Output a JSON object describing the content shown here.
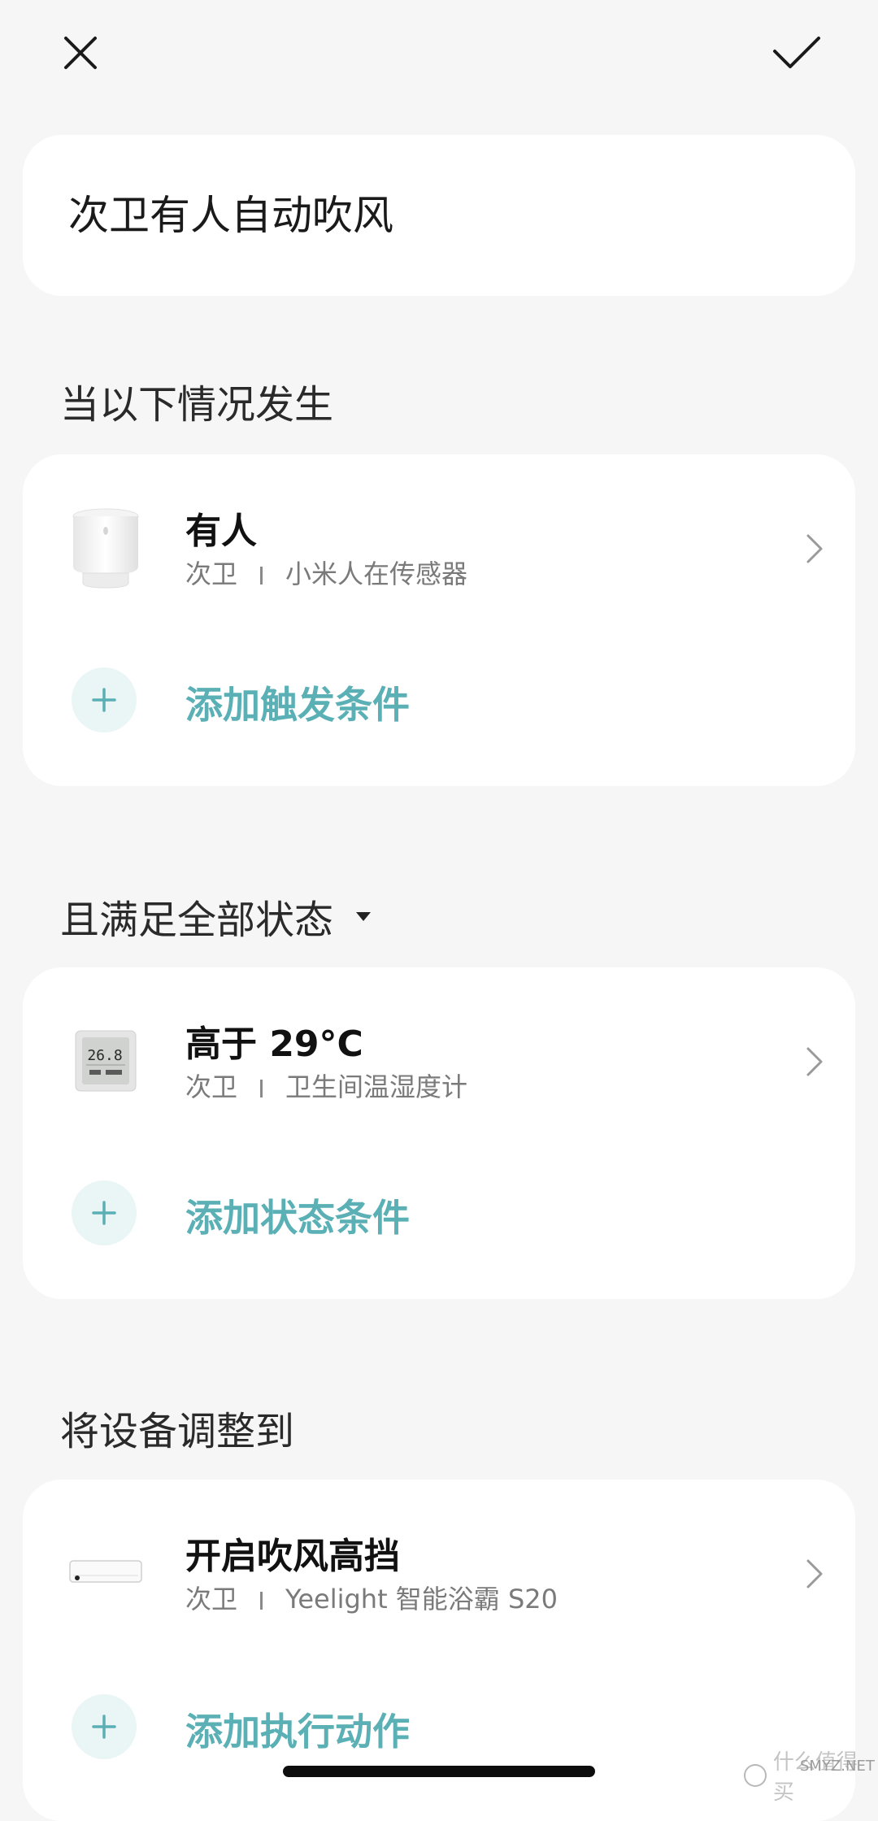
{
  "top_bar": {
    "close_icon": "close-icon",
    "confirm_icon": "check-icon"
  },
  "scene_name": "次卫有人自动吹风",
  "trigger_section": {
    "title": "当以下情况发生",
    "item": {
      "title": "有人",
      "room": "次卫",
      "device": "小米人在传感器",
      "icon": "motion-sensor-icon"
    },
    "add_label": "添加触发条件"
  },
  "condition_section": {
    "title": "且满足全部状态",
    "item": {
      "title": "高于 29°C",
      "room": "次卫",
      "device": "卫生间温湿度计",
      "icon": "thermometer-hygrometer-icon",
      "display_reading": "26.8"
    },
    "add_label": "添加状态条件"
  },
  "action_section": {
    "title": "将设备调整到",
    "item": {
      "title": "开启吹风高挡",
      "room": "次卫",
      "device": "Yeelight 智能浴霸 S20",
      "icon": "bath-heater-icon"
    },
    "add_label": "添加执行动作"
  },
  "watermark": {
    "text": "什么值得买",
    "url": "SMYZ.NET"
  },
  "colors": {
    "accent": "#5ab0b4",
    "background": "#f6f6f6",
    "card": "#ffffff",
    "plus_circle_bg": "#eaf5f5"
  }
}
